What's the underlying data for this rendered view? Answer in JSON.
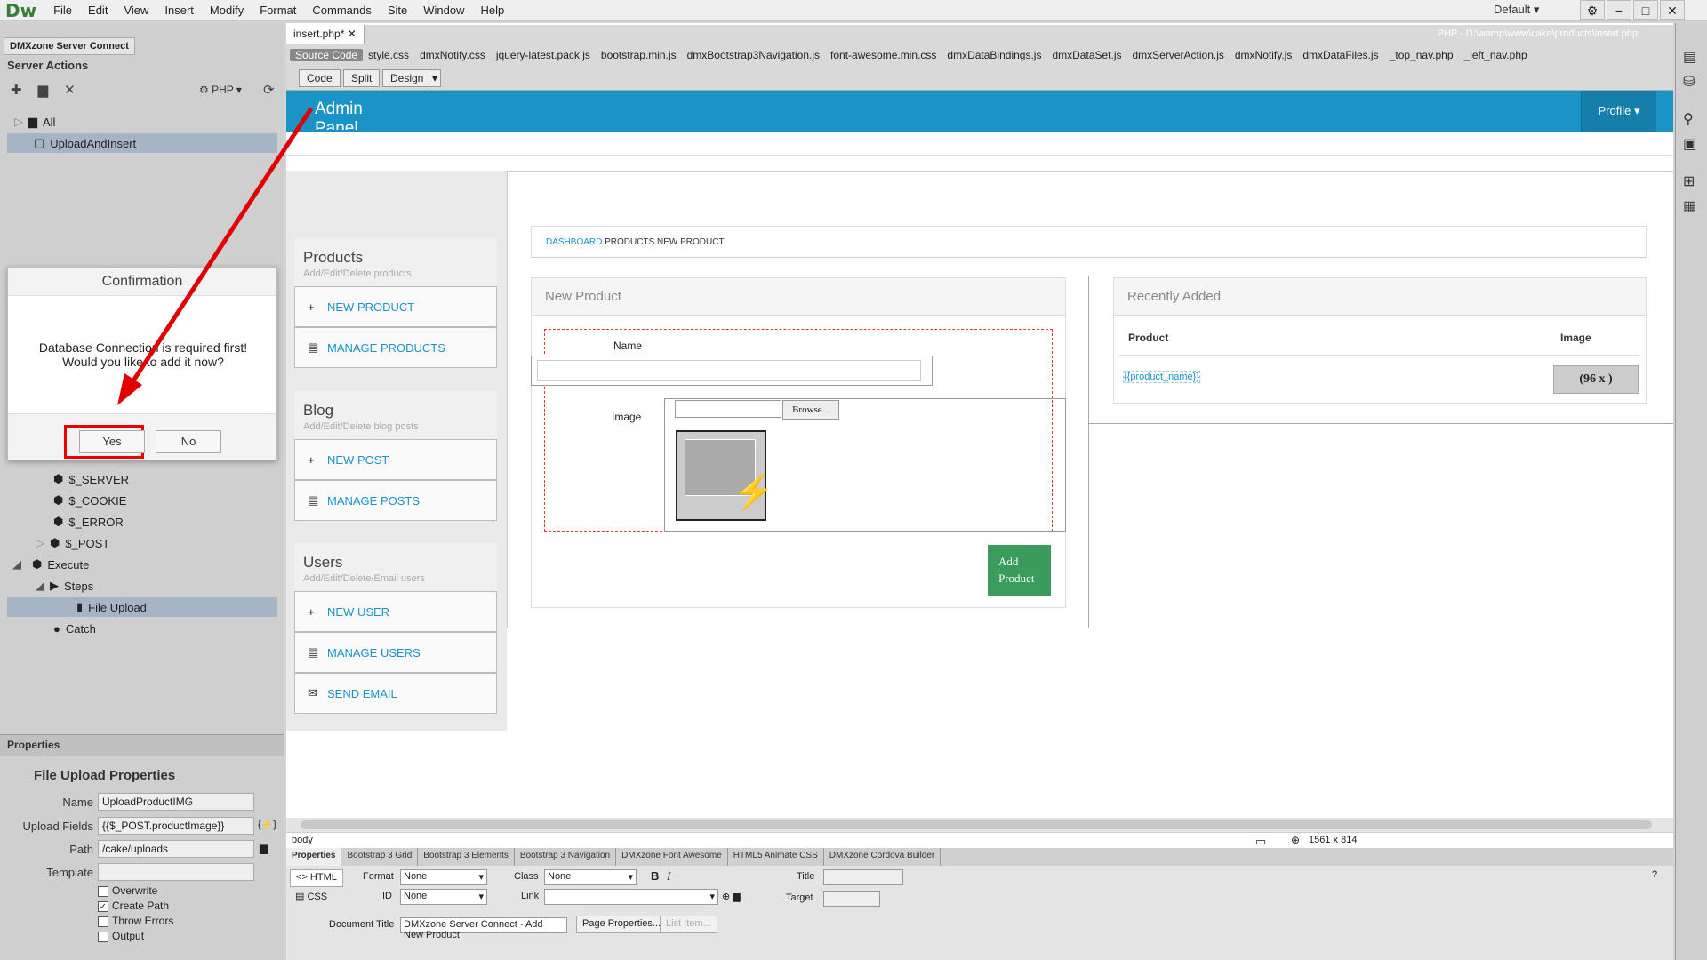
{
  "menubar": {
    "logo": "Dw",
    "items": [
      "File",
      "Edit",
      "View",
      "Insert",
      "Modify",
      "Format",
      "Commands",
      "Site",
      "Window",
      "Help"
    ],
    "workspace": "Default"
  },
  "leftpanel": {
    "tab": "DMXzone Server Connect",
    "section_title": "Server Actions",
    "lang": "PHP",
    "tree": [
      {
        "label": "All"
      },
      {
        "label": "UploadAndInsert"
      },
      {
        "label": "$_SERVER"
      },
      {
        "label": "$_COOKIE"
      },
      {
        "label": "$_ERROR"
      },
      {
        "label": "$_POST"
      },
      {
        "label": "Execute"
      },
      {
        "label": "Steps"
      },
      {
        "label": "File Upload"
      },
      {
        "label": "Catch"
      }
    ]
  },
  "dialog": {
    "title": "Confirmation",
    "message_line1": "Database Connection is required first!",
    "message_line2": "Would you like to add it now?",
    "yes": "Yes",
    "no": "No"
  },
  "properties_left": {
    "title": "Properties",
    "subtitle": "File Upload Properties",
    "name_label": "Name",
    "name_value": "UploadProductIMG",
    "fields_label": "Upload Fields",
    "fields_value": "{{$_POST.productImage}}",
    "path_label": "Path",
    "path_value": "/cake/uploads",
    "template_label": "Template",
    "template_value": "",
    "overwrite": "Overwrite",
    "create_path": "Create Path",
    "throw_errors": "Throw Errors",
    "output": "Output"
  },
  "document": {
    "tab": "insert.php*",
    "path": "PHP - D:\\wamp\\www\\cake\\products\\insert.php",
    "files": [
      "Source Code",
      "style.css",
      "dmxNotify.css",
      "jquery-latest.pack.js",
      "bootstrap.min.js",
      "dmxBootstrap3Navigation.js",
      "font-awesome.min.css",
      "dmxDataBindings.js",
      "dmxDataSet.js",
      "dmxServerAction.js",
      "dmxNotify.js",
      "dmxDataFiles.js",
      "_top_nav.php",
      "_left_nav.php"
    ],
    "views": {
      "code": "Code",
      "split": "Split",
      "design": "Design"
    }
  },
  "page": {
    "brand": "Admin Panel",
    "profile": "Profile",
    "breadcrumb": {
      "dashboard": "DASHBOARD",
      "rest": "PRODUCTS NEW PRODUCT"
    },
    "sidebar": [
      {
        "title": "Products",
        "sub": "Add/Edit/Delete products",
        "items": [
          {
            "label": "NEW PRODUCT",
            "icon": "+"
          },
          {
            "label": "MANAGE PRODUCTS",
            "icon": "▤"
          }
        ]
      },
      {
        "title": "Blog",
        "sub": "Add/Edit/Delete blog posts",
        "items": [
          {
            "label": "NEW POST",
            "icon": "+"
          },
          {
            "label": "MANAGE POSTS",
            "icon": "▤"
          }
        ]
      },
      {
        "title": "Users",
        "sub": "Add/Edit/Delete/Email users",
        "items": [
          {
            "label": "NEW USER",
            "icon": "+"
          },
          {
            "label": "MANAGE USERS",
            "icon": "▤"
          },
          {
            "label": "SEND EMAIL",
            "icon": "✉"
          }
        ]
      }
    ],
    "new_product": {
      "title": "New Product",
      "name_label": "Name",
      "image_label": "Image",
      "browse": "Browse...",
      "add_button": "Add Product"
    },
    "recent": {
      "title": "Recently Added",
      "col_product": "Product",
      "col_image": "Image",
      "product_binding": "{{product_name}}",
      "image_placeholder": "(96 x )"
    }
  },
  "statusbar": {
    "tag": "body",
    "size": "1561 x 814"
  },
  "proptabs": [
    "Properties",
    "Bootstrap 3 Grid",
    "Bootstrap 3 Elements",
    "Bootstrap 3 Navigation",
    "DMXzone Font Awesome",
    "HTML5 Animate CSS",
    "DMXzone Cordova Builder"
  ],
  "inspector": {
    "html": "HTML",
    "css": "CSS",
    "format_label": "Format",
    "format_value": "None",
    "id_label": "ID",
    "id_value": "None",
    "class_label": "Class",
    "class_value": "None",
    "link_label": "Link",
    "link_value": "",
    "title_label": "Title",
    "target_label": "Target",
    "doc_title_label": "Document Title",
    "doc_title_value": "DMXzone Server Connect - Add New Product",
    "page_props": "Page Properties...",
    "list_item": "List Item..."
  },
  "colors": {
    "accent": "#1a94c6",
    "green": "#3a9b5c",
    "annotation": "#e00000"
  }
}
